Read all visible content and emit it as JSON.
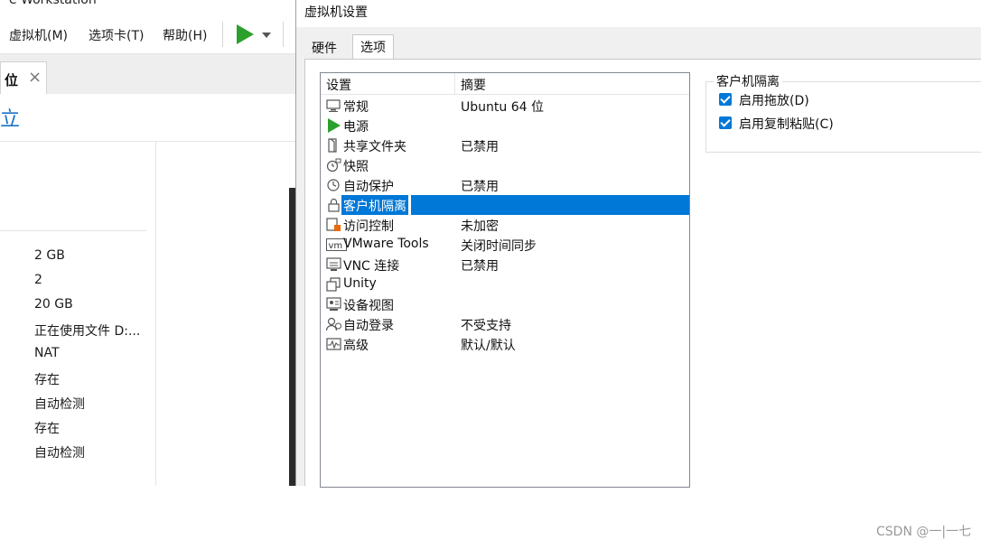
{
  "background_window": {
    "title": "e Workstation",
    "menu": [
      "虚拟机(M)",
      "选项卡(T)",
      "帮助(H)"
    ],
    "tab_label": "位",
    "tab_close": "×",
    "link_text": "立",
    "device_values": [
      "2 GB",
      "2",
      "20 GB",
      "正在使用文件 D:...",
      "NAT",
      "存在",
      "自动检测",
      "存在",
      "自动检测"
    ]
  },
  "dialog": {
    "title": "虚拟机设置",
    "tabs": [
      "硬件",
      "选项"
    ],
    "active_tab": "选项",
    "list": {
      "headers": {
        "setting": "设置",
        "summary": "摘要"
      },
      "rows": [
        {
          "icon": "general-icon",
          "name": "常规",
          "summary": "Ubuntu 64 位"
        },
        {
          "icon": "power-icon",
          "name": "电源",
          "summary": ""
        },
        {
          "icon": "shared-folders-icon",
          "name": "共享文件夹",
          "summary": "已禁用"
        },
        {
          "icon": "snapshot-icon",
          "name": "快照",
          "summary": ""
        },
        {
          "icon": "autoprotect-icon",
          "name": "自动保护",
          "summary": "已禁用"
        },
        {
          "icon": "lock-icon",
          "name": "客户机隔离",
          "summary": ""
        },
        {
          "icon": "access-control-icon",
          "name": "访问控制",
          "summary": "未加密"
        },
        {
          "icon": "vmware-tools-icon",
          "name": "VMware Tools",
          "summary": "关闭时间同步"
        },
        {
          "icon": "vnc-icon",
          "name": "VNC 连接",
          "summary": "已禁用"
        },
        {
          "icon": "unity-icon",
          "name": "Unity",
          "summary": ""
        },
        {
          "icon": "appliance-view-icon",
          "name": "设备视图",
          "summary": ""
        },
        {
          "icon": "autologin-icon",
          "name": "自动登录",
          "summary": "不受支持"
        },
        {
          "icon": "advanced-icon",
          "name": "高级",
          "summary": "默认/默认"
        }
      ],
      "selected": "客户机隔离"
    },
    "isolation_group": {
      "title": "客户机隔离",
      "options": [
        {
          "label": "启用拖放(D)",
          "checked": true
        },
        {
          "label": "启用复制粘贴(C)",
          "checked": true
        }
      ]
    }
  },
  "watermark": "CSDN @一|一七",
  "colors": {
    "selection": "#0078d7",
    "play": "#2ca02c",
    "link": "#1a73c8"
  }
}
